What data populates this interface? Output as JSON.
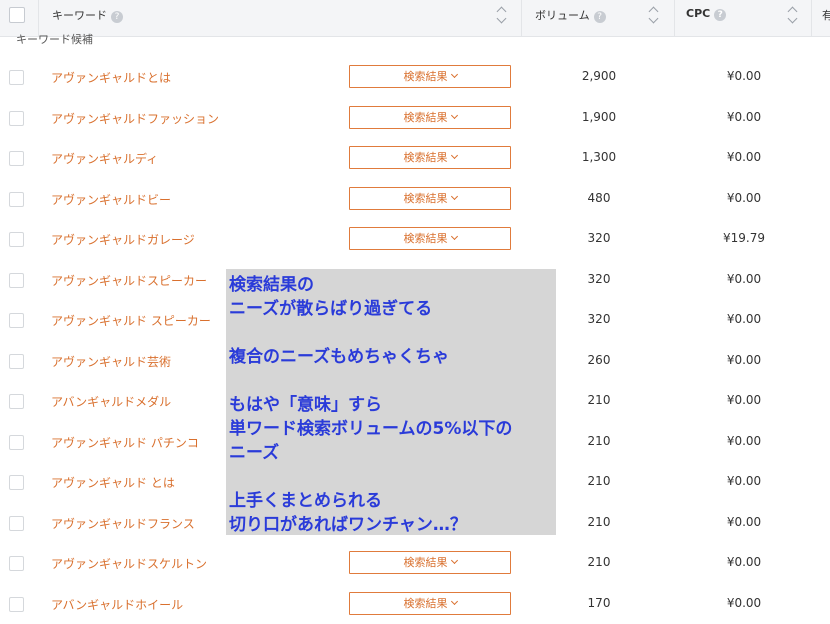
{
  "header": {
    "keyword_label": "キーワード",
    "volume_label": "ボリューム",
    "cpc_label": "CPC",
    "help": "?",
    "partial_col": "有"
  },
  "group_label": "キーワード候補",
  "serp_label": "検索結果",
  "rows": [
    {
      "keyword": "アヴァンギャルドとは",
      "volume": "2,900",
      "cpc": "¥0.00",
      "serp": true
    },
    {
      "keyword": "アヴァンギャルドファッション",
      "volume": "1,900",
      "cpc": "¥0.00",
      "serp": true
    },
    {
      "keyword": "アヴァンギャルディ",
      "volume": "1,300",
      "cpc": "¥0.00",
      "serp": true
    },
    {
      "keyword": "アヴァンギャルドビー",
      "volume": "480",
      "cpc": "¥0.00",
      "serp": true
    },
    {
      "keyword": "アヴァンギャルドガレージ",
      "volume": "320",
      "cpc": "¥19.79",
      "serp": true
    },
    {
      "keyword": "アヴァンギャルドスピーカー",
      "volume": "320",
      "cpc": "¥0.00",
      "serp": false
    },
    {
      "keyword": "アヴァンギャルド スピーカー",
      "volume": "320",
      "cpc": "¥0.00",
      "serp": false
    },
    {
      "keyword": "アヴァンギャルド芸術",
      "volume": "260",
      "cpc": "¥0.00",
      "serp": false
    },
    {
      "keyword": "アバンギャルドメダル",
      "volume": "210",
      "cpc": "¥0.00",
      "serp": false
    },
    {
      "keyword": "アヴァンギャルド パチンコ",
      "volume": "210",
      "cpc": "¥0.00",
      "serp": false
    },
    {
      "keyword": "アヴァンギャルド とは",
      "volume": "210",
      "cpc": "¥0.00",
      "serp": false
    },
    {
      "keyword": "アヴァンギャルドフランス",
      "volume": "210",
      "cpc": "¥0.00",
      "serp": false
    },
    {
      "keyword": "アヴァンギャルドスケルトン",
      "volume": "210",
      "cpc": "¥0.00",
      "serp": true
    },
    {
      "keyword": "アバンギャルドホイール",
      "volume": "170",
      "cpc": "¥0.00",
      "serp": true
    }
  ],
  "overlay_lines": [
    "検索結果の",
    "ニーズが散らばり過ぎてる",
    "",
    "複合のニーズもめちゃくちゃ",
    "",
    "もはや「意味」すら",
    "単ワード検索ボリュームの5%以下の",
    "ニーズ",
    "",
    "上手くまとめられる",
    "切り口があればワンチャン…？"
  ]
}
